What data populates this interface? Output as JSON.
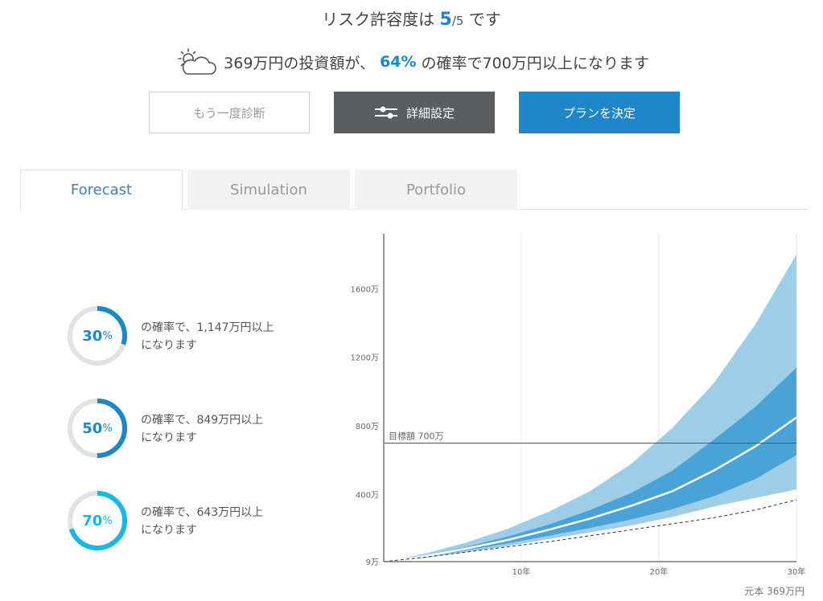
{
  "header": {
    "risk_prefix": "リスク許容度は ",
    "risk_level": "5",
    "risk_slash": "/",
    "risk_max": "5",
    "risk_suffix": " です",
    "headline_pre": "369万円の投資額が、",
    "headline_pct": "64%",
    "headline_post": "の確率で700万円以上になります",
    "weather_icon": "partly-cloudy-icon"
  },
  "buttons": {
    "rediagnose": "もう一度診断",
    "settings": "詳細設定",
    "decide": "プランを決定"
  },
  "tabs": [
    {
      "label": "Forecast",
      "active": true
    },
    {
      "label": "Simulation",
      "active": false
    },
    {
      "label": "Portfolio",
      "active": false
    }
  ],
  "probabilities": [
    {
      "percent": 30,
      "value_label": "30",
      "unit": "%",
      "line1": "の確率で、1,147万円以上",
      "line2": "になります",
      "color": "#1d87c8"
    },
    {
      "percent": 50,
      "value_label": "50",
      "unit": "%",
      "line1": "の確率で、849万円以上",
      "line2": "になります",
      "color": "#1d87c8"
    },
    {
      "percent": 70,
      "value_label": "70",
      "unit": "%",
      "line1": "の確率で、643万円以上",
      "line2": "になります",
      "color": "#19b6e8"
    }
  ],
  "colors": {
    "accent": "#1d87c8",
    "ring_track": "#e2e2e2",
    "outer_band": "#9ecde8",
    "inner_band": "#4aa3d6",
    "median": "#ffffff"
  },
  "chart_data": {
    "type": "area",
    "x": [
      0,
      3,
      6,
      9,
      12,
      15,
      18,
      21,
      24,
      27,
      30
    ],
    "y_ticks": [
      {
        "value": 9,
        "label": "9万"
      },
      {
        "value": 400,
        "label": "400万"
      },
      {
        "value": 800,
        "label": "800万"
      },
      {
        "value": 1200,
        "label": "1200万"
      },
      {
        "value": 1600,
        "label": "1600万"
      }
    ],
    "x_ticks": [
      {
        "value": 10,
        "label": "10年"
      },
      {
        "value": 20,
        "label": "20年"
      },
      {
        "value": 30,
        "label": "30年"
      }
    ],
    "xlim": [
      0,
      30
    ],
    "ylim": [
      9,
      1920
    ],
    "bands": [
      {
        "upper": [
          9,
          55,
          120,
          200,
          300,
          420,
          580,
          790,
          1050,
          1390,
          1800
        ],
        "lower": [
          9,
          30,
          65,
          100,
          140,
          180,
          220,
          270,
          330,
          380,
          430
        ]
      },
      {
        "upper": [
          9,
          45,
          95,
          155,
          225,
          310,
          410,
          540,
          720,
          910,
          1140
        ],
        "lower": [
          9,
          35,
          75,
          115,
          160,
          205,
          255,
          315,
          390,
          490,
          630
        ]
      }
    ],
    "median": [
      9,
      40,
      85,
      135,
      195,
      260,
      335,
      420,
      540,
      680,
      849
    ],
    "principal": [
      9,
      35,
      65,
      95,
      125,
      160,
      195,
      230,
      265,
      310,
      369
    ],
    "target": {
      "value": 700,
      "label": "目標額 700万"
    },
    "principal_label": "元本 369万円"
  }
}
